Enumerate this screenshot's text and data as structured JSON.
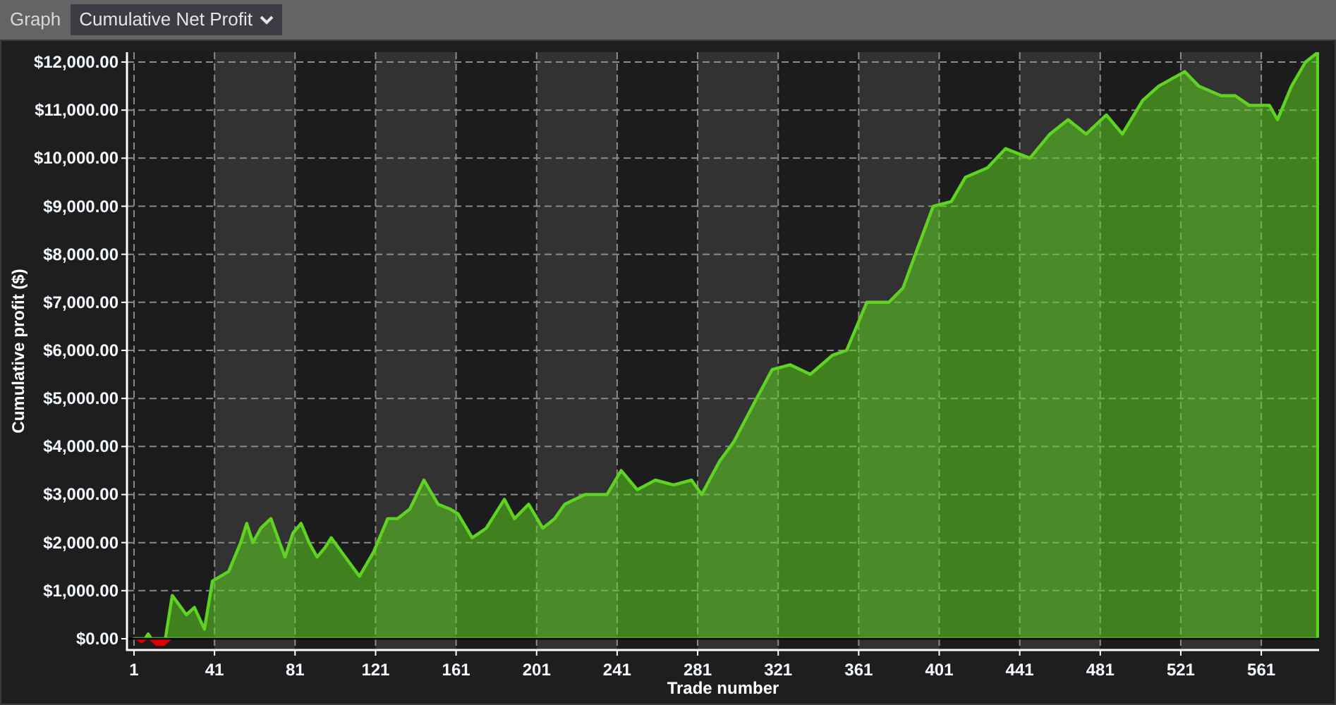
{
  "toolbar": {
    "label": "Graph",
    "dropdown": {
      "value": "Cumulative Net Profit"
    }
  },
  "chart": {
    "chart_data": {
      "type": "area",
      "xlabel": "Trade number",
      "ylabel": "Cumulative profit ($)",
      "x": [
        1,
        5,
        8,
        12,
        16,
        20,
        27,
        31,
        36,
        40,
        48,
        54,
        57,
        60,
        64,
        69,
        76,
        80,
        84,
        88,
        92,
        96,
        99,
        106,
        113,
        120,
        127,
        132,
        138,
        145,
        152,
        158,
        162,
        169,
        176,
        185,
        190,
        197,
        204,
        210,
        215,
        225,
        236,
        243,
        251,
        260,
        269,
        278,
        283,
        292,
        299,
        309,
        318,
        327,
        337,
        348,
        355,
        365,
        376,
        383,
        390,
        398,
        407,
        414,
        425,
        434,
        446,
        456,
        465,
        474,
        484,
        492,
        502,
        510,
        523,
        530,
        541,
        548,
        555,
        565,
        569,
        576,
        583,
        589
      ],
      "series": [
        {
          "color": "#5fd321",
          "values": [
            0,
            -100,
            100,
            -150,
            -150,
            900,
            500,
            650,
            200,
            1200,
            1400,
            2000,
            2400,
            2000,
            2300,
            2500,
            1700,
            2200,
            2400,
            2000,
            1700,
            1900,
            2100,
            1700,
            1300,
            1800,
            2500,
            2500,
            2700,
            3300,
            2800,
            2700,
            2600,
            2100,
            2300,
            2900,
            2500,
            2800,
            2300,
            2500,
            2800,
            3000,
            3000,
            3500,
            3100,
            3300,
            3200,
            3300,
            3000,
            3700,
            4100,
            4900,
            5600,
            5700,
            5500,
            5900,
            6000,
            7000,
            7000,
            7300,
            8100,
            9000,
            9100,
            9600,
            9800,
            10200,
            10000,
            10500,
            10800,
            10500,
            10900,
            10500,
            11200,
            11500,
            11800,
            11500,
            11300,
            11300,
            11100,
            11100,
            10800,
            11500,
            12000,
            12200
          ]
        }
      ],
      "grid": true,
      "xlim": [
        -2.5,
        589.7
      ],
      "ylim": [
        -235,
        12206
      ],
      "xticks": [
        1,
        41,
        81,
        121,
        161,
        201,
        241,
        281,
        321,
        361,
        401,
        441,
        481,
        521,
        561
      ],
      "yticks": [
        {
          "value": 0,
          "label": "$0.00"
        },
        {
          "value": 1000,
          "label": "$1,000.00"
        },
        {
          "value": 2000,
          "label": "$2,000.00"
        },
        {
          "value": 3000,
          "label": "$3,000.00"
        },
        {
          "value": 4000,
          "label": "$4,000.00"
        },
        {
          "value": 5000,
          "label": "$5,000.00"
        },
        {
          "value": 6000,
          "label": "$6,000.00"
        },
        {
          "value": 7000,
          "label": "$7,000.00"
        },
        {
          "value": 8000,
          "label": "$8,000.00"
        },
        {
          "value": 9000,
          "label": "$9,000.00"
        },
        {
          "value": 10000,
          "label": "$10,000.00"
        },
        {
          "value": 11000,
          "label": "$11,000.00"
        },
        {
          "value": 12000,
          "label": "$12,000.00"
        }
      ]
    }
  }
}
